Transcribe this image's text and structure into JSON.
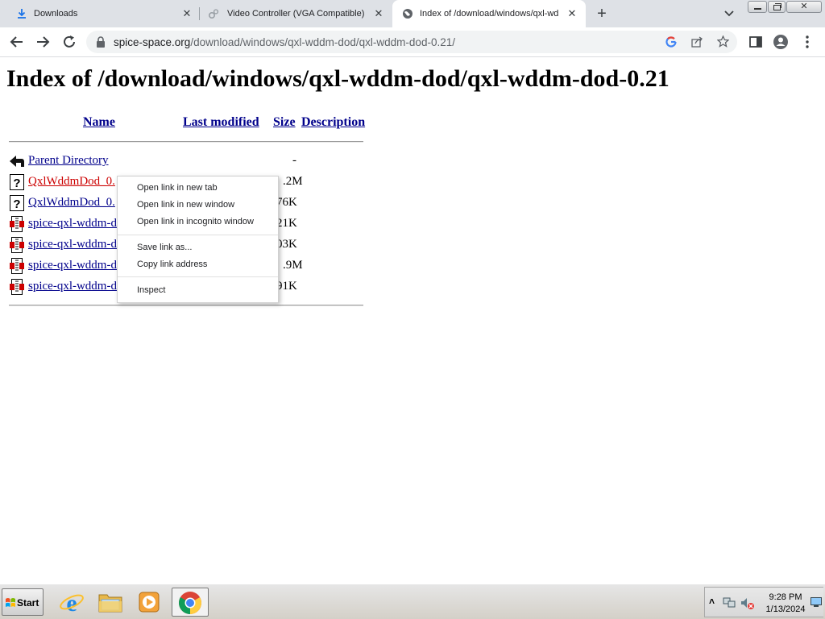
{
  "colors": {
    "link": "#00008b",
    "visited_link": "#cc0000",
    "tab_strip": "#dee1e6",
    "omnibox": "#f1f3f4"
  },
  "tabs": [
    {
      "title": "Downloads",
      "icon": "download-icon",
      "active": false
    },
    {
      "title": "Video Controller (VGA Compatible) D",
      "icon": "gear-icon",
      "active": false
    },
    {
      "title": "Index of /download/windows/qxl-wd",
      "icon": "globe-icon",
      "active": true
    }
  ],
  "omnibox": {
    "host": "spice-space.org",
    "path": "/download/windows/qxl-wddm-dod/qxl-wddm-dod-0.21/"
  },
  "page": {
    "title": "Index of /download/windows/qxl-wddm-dod/qxl-wddm-dod-0.21",
    "columns": {
      "name": "Name",
      "last_modified": "Last modified",
      "size": "Size",
      "description": "Description"
    },
    "rows": [
      {
        "icon": "back-arrow-icon",
        "name": "Parent Directory",
        "size": "-"
      },
      {
        "icon": "unknown-file-icon",
        "name": "QxlWddmDod_0.",
        "size": ".2M"
      },
      {
        "icon": "unknown-file-icon",
        "name": "QxlWddmDod_0.",
        "size": "76K"
      },
      {
        "icon": "archive-file-icon",
        "name": "spice-qxl-wddm-d",
        "size": "21K"
      },
      {
        "icon": "archive-file-icon",
        "name": "spice-qxl-wddm-d",
        "size": "03K"
      },
      {
        "icon": "archive-file-icon",
        "name": "spice-qxl-wddm-d",
        "size": ".9M"
      },
      {
        "icon": "archive-file-icon",
        "name": "spice-qxl-wddm-d",
        "size": "91K"
      }
    ]
  },
  "context_menu": {
    "items": [
      {
        "label": "Open link in new tab"
      },
      {
        "label": "Open link in new window"
      },
      {
        "label": "Open link in incognito window"
      },
      {
        "label": "Save link as..."
      },
      {
        "label": "Copy link address"
      },
      {
        "label": "Inspect"
      }
    ]
  },
  "taskbar": {
    "start_label": "Start",
    "apps": [
      "ie-icon",
      "explorer-folder-icon",
      "media-player-icon",
      "chrome-icon"
    ],
    "clock": {
      "time": "9:28 PM",
      "date": "1/13/2024"
    }
  }
}
